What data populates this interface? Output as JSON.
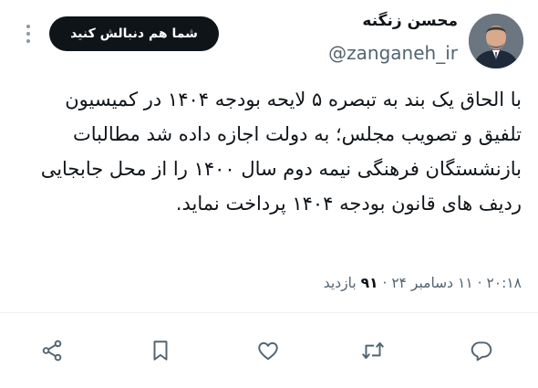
{
  "tweet": {
    "author_name": "محسن زنگنه",
    "author_handle": "@zanganeh_ir",
    "follow_label": "شما هم دنبالش کنید",
    "text": "با الحاق یک بند به تبصره ۵ لایحه بودجه ۱۴۰۴ در کمیسیون تلفیق و تصویب مجلس؛ به دولت اجازه داده شد مطالبات بازنشستگان فرهنگی نیمه دوم سال ۱۴۰۰ را از محل جابجایی ردیف های قانون بودجه ۱۴۰۴ پرداخت نماید.",
    "time": "۲۰:۱۸",
    "separator": "·",
    "date": "۱۱ دسامبر ۲۴",
    "views_count": "۹۱",
    "views_label": "بازدید"
  },
  "icons": {
    "more": "more-vertical-icon",
    "reply": "reply-icon",
    "retweet": "retweet-icon",
    "like": "heart-icon",
    "bookmark": "bookmark-icon",
    "share": "share-icon"
  },
  "colors": {
    "text": "#0f1419",
    "secondary": "#536471",
    "button_bg": "#0f1419",
    "divider": "#eff3f4"
  }
}
